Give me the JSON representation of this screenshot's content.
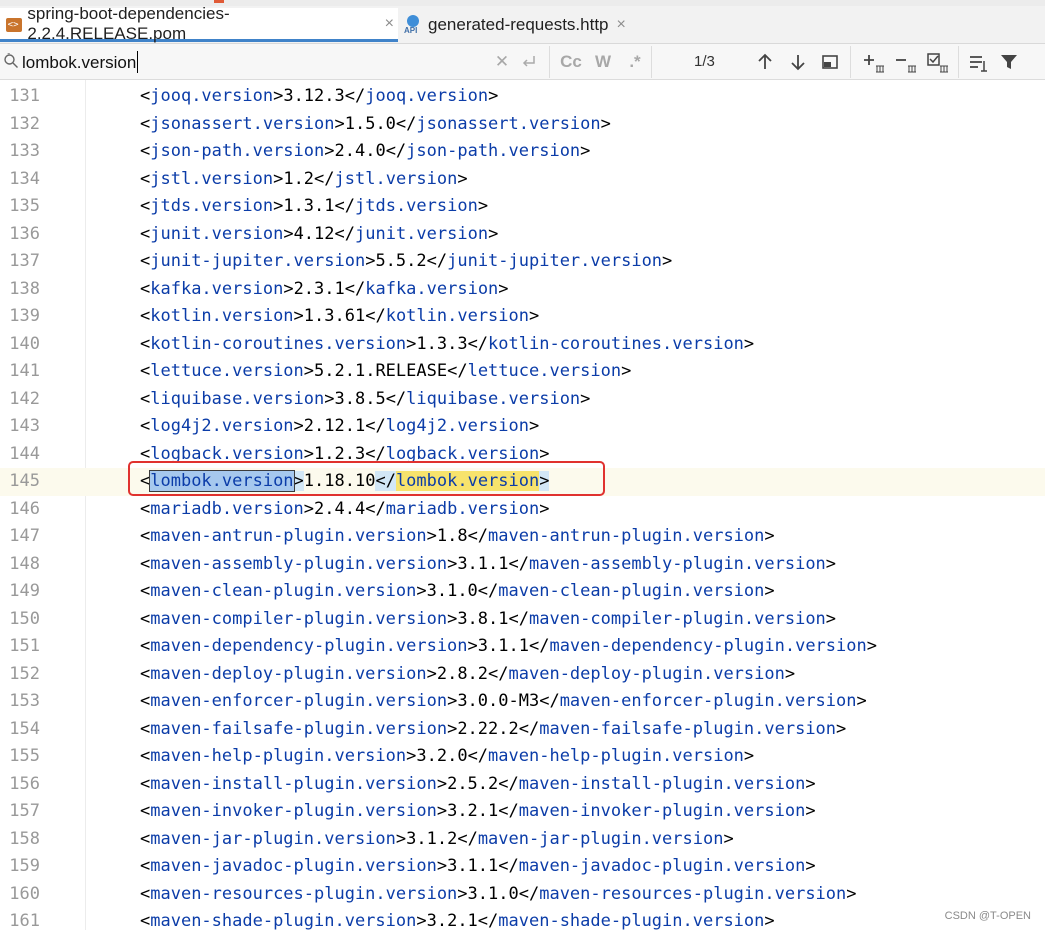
{
  "tabs": [
    {
      "label": "spring-boot-dependencies-2.2.4.RELEASE.pom",
      "icon": "pom-file-icon",
      "active": true
    },
    {
      "label": "generated-requests.http",
      "icon": "api-file-icon",
      "active": false
    }
  ],
  "tab_close_glyph": "×",
  "api_badge": "API",
  "search": {
    "value": "lombok.version",
    "match_count": "1/3",
    "case_label": "Cc",
    "word_label": "W",
    "regex_label": ".*"
  },
  "editor": {
    "current_line": 145,
    "lines": [
      {
        "num": "131",
        "tag": "jooq.version",
        "value": "3.12.3"
      },
      {
        "num": "132",
        "tag": "jsonassert.version",
        "value": "1.5.0"
      },
      {
        "num": "133",
        "tag": "json-path.version",
        "value": "2.4.0"
      },
      {
        "num": "134",
        "tag": "jstl.version",
        "value": "1.2"
      },
      {
        "num": "135",
        "tag": "jtds.version",
        "value": "1.3.1"
      },
      {
        "num": "136",
        "tag": "junit.version",
        "value": "4.12"
      },
      {
        "num": "137",
        "tag": "junit-jupiter.version",
        "value": "5.5.2"
      },
      {
        "num": "138",
        "tag": "kafka.version",
        "value": "2.3.1"
      },
      {
        "num": "139",
        "tag": "kotlin.version",
        "value": "1.3.61"
      },
      {
        "num": "140",
        "tag": "kotlin-coroutines.version",
        "value": "1.3.3"
      },
      {
        "num": "141",
        "tag": "lettuce.version",
        "value": "5.2.1.RELEASE"
      },
      {
        "num": "142",
        "tag": "liquibase.version",
        "value": "3.8.5"
      },
      {
        "num": "143",
        "tag": "log4j2.version",
        "value": "2.12.1"
      },
      {
        "num": "144",
        "tag": "logback.version",
        "value": "1.2.3"
      },
      {
        "num": "145",
        "tag": "lombok.version",
        "value": "1.18.10"
      },
      {
        "num": "146",
        "tag": "mariadb.version",
        "value": "2.4.4"
      },
      {
        "num": "147",
        "tag": "maven-antrun-plugin.version",
        "value": "1.8"
      },
      {
        "num": "148",
        "tag": "maven-assembly-plugin.version",
        "value": "3.1.1"
      },
      {
        "num": "149",
        "tag": "maven-clean-plugin.version",
        "value": "3.1.0"
      },
      {
        "num": "150",
        "tag": "maven-compiler-plugin.version",
        "value": "3.8.1"
      },
      {
        "num": "151",
        "tag": "maven-dependency-plugin.version",
        "value": "3.1.1"
      },
      {
        "num": "152",
        "tag": "maven-deploy-plugin.version",
        "value": "2.8.2"
      },
      {
        "num": "153",
        "tag": "maven-enforcer-plugin.version",
        "value": "3.0.0-M3"
      },
      {
        "num": "154",
        "tag": "maven-failsafe-plugin.version",
        "value": "2.22.2"
      },
      {
        "num": "155",
        "tag": "maven-help-plugin.version",
        "value": "3.2.0"
      },
      {
        "num": "156",
        "tag": "maven-install-plugin.version",
        "value": "2.5.2"
      },
      {
        "num": "157",
        "tag": "maven-invoker-plugin.version",
        "value": "3.2.1"
      },
      {
        "num": "158",
        "tag": "maven-jar-plugin.version",
        "value": "3.1.2"
      },
      {
        "num": "159",
        "tag": "maven-javadoc-plugin.version",
        "value": "3.1.1"
      },
      {
        "num": "160",
        "tag": "maven-resources-plugin.version",
        "value": "3.1.0"
      },
      {
        "num": "161",
        "tag": "maven-shade-plugin.version",
        "value": "3.2.1"
      }
    ]
  },
  "colors": {
    "tag": "#0b3ca8",
    "selection": "#a6c8ee",
    "match_highlight": "#f7e36c",
    "annotation_box": "#e0322f",
    "active_tab_underline": "#4083c9"
  },
  "watermark": "CSDN @T-OPEN"
}
